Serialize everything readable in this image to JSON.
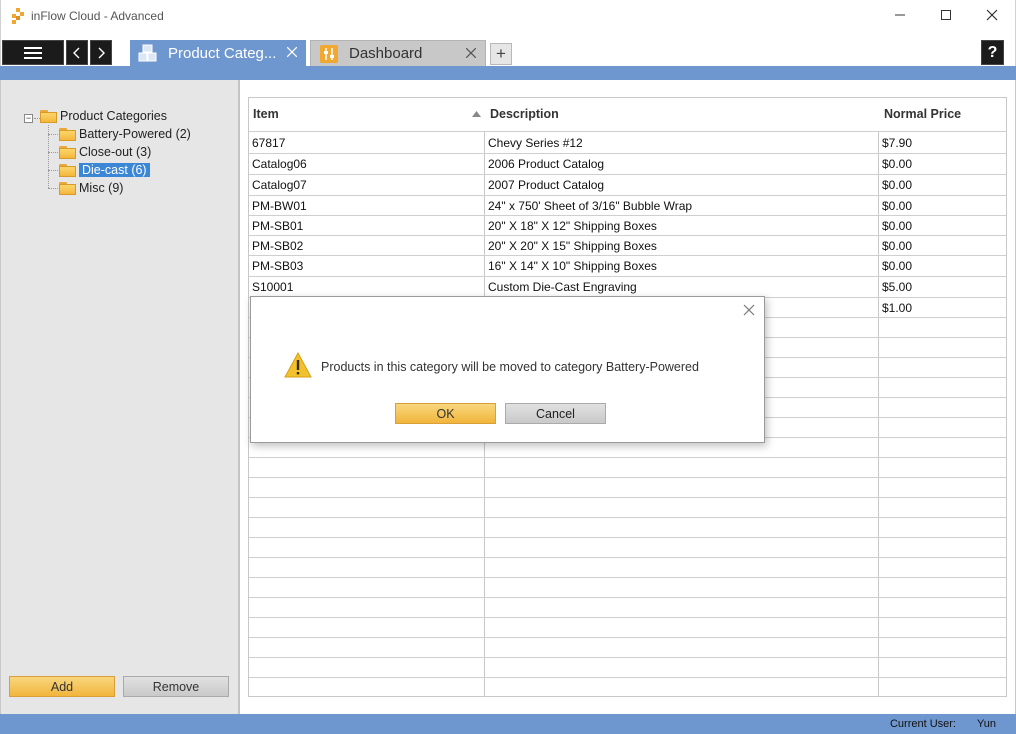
{
  "window": {
    "title": "inFlow Cloud - Advanced",
    "minimize_icon": "minimize-icon",
    "maximize_icon": "maximize-icon",
    "close_icon": "close-icon"
  },
  "tabs": [
    {
      "label": "Product Categ...",
      "icon": "boxes-icon",
      "active": true
    },
    {
      "label": "Dashboard",
      "icon": "dashboard-icon",
      "active": false
    }
  ],
  "toolbar": {
    "add_tab": "+",
    "help": "?"
  },
  "tree": {
    "root": "Product Categories",
    "items": [
      {
        "label": "Battery-Powered (2)",
        "selected": false
      },
      {
        "label": "Close-out (3)",
        "selected": false
      },
      {
        "label": "Die-cast (6)",
        "selected": true
      },
      {
        "label": "Misc (9)",
        "selected": false
      }
    ]
  },
  "left_buttons": {
    "add": "Add",
    "remove": "Remove"
  },
  "grid": {
    "columns": [
      "Item",
      "Description",
      "Normal Price"
    ],
    "rows": [
      {
        "item": "67817",
        "description": "Chevy Series #12",
        "price": "$7.90"
      },
      {
        "item": "Catalog06",
        "description": "2006 Product Catalog",
        "price": "$0.00"
      },
      {
        "item": "Catalog07",
        "description": "2007 Product Catalog",
        "price": "$0.00"
      },
      {
        "item": "PM-BW01",
        "description": "24\" x 750' Sheet of 3/16\" Bubble Wrap",
        "price": "$0.00"
      },
      {
        "item": "PM-SB01",
        "description": "20\" X 18\" X 12\" Shipping Boxes",
        "price": "$0.00"
      },
      {
        "item": "PM-SB02",
        "description": "20\" X 20\" X 15\" Shipping Boxes",
        "price": "$0.00"
      },
      {
        "item": "PM-SB03",
        "description": "16\" X 14\" X 10\" Shipping Boxes",
        "price": "$0.00"
      },
      {
        "item": "S10001",
        "description": "Custom Die-Cast Engraving",
        "price": "$5.00"
      },
      {
        "item": "",
        "description": "",
        "price": "$1.00"
      }
    ]
  },
  "status": {
    "label": "Current User:",
    "user": "Yun"
  },
  "dialog": {
    "message": "Products in this category will be moved to category Battery-Powered",
    "ok": "OK",
    "cancel": "Cancel"
  },
  "colors": {
    "accent": "#6f97cf",
    "selection": "#3c86d6",
    "button_gold": "#f1b53c"
  }
}
